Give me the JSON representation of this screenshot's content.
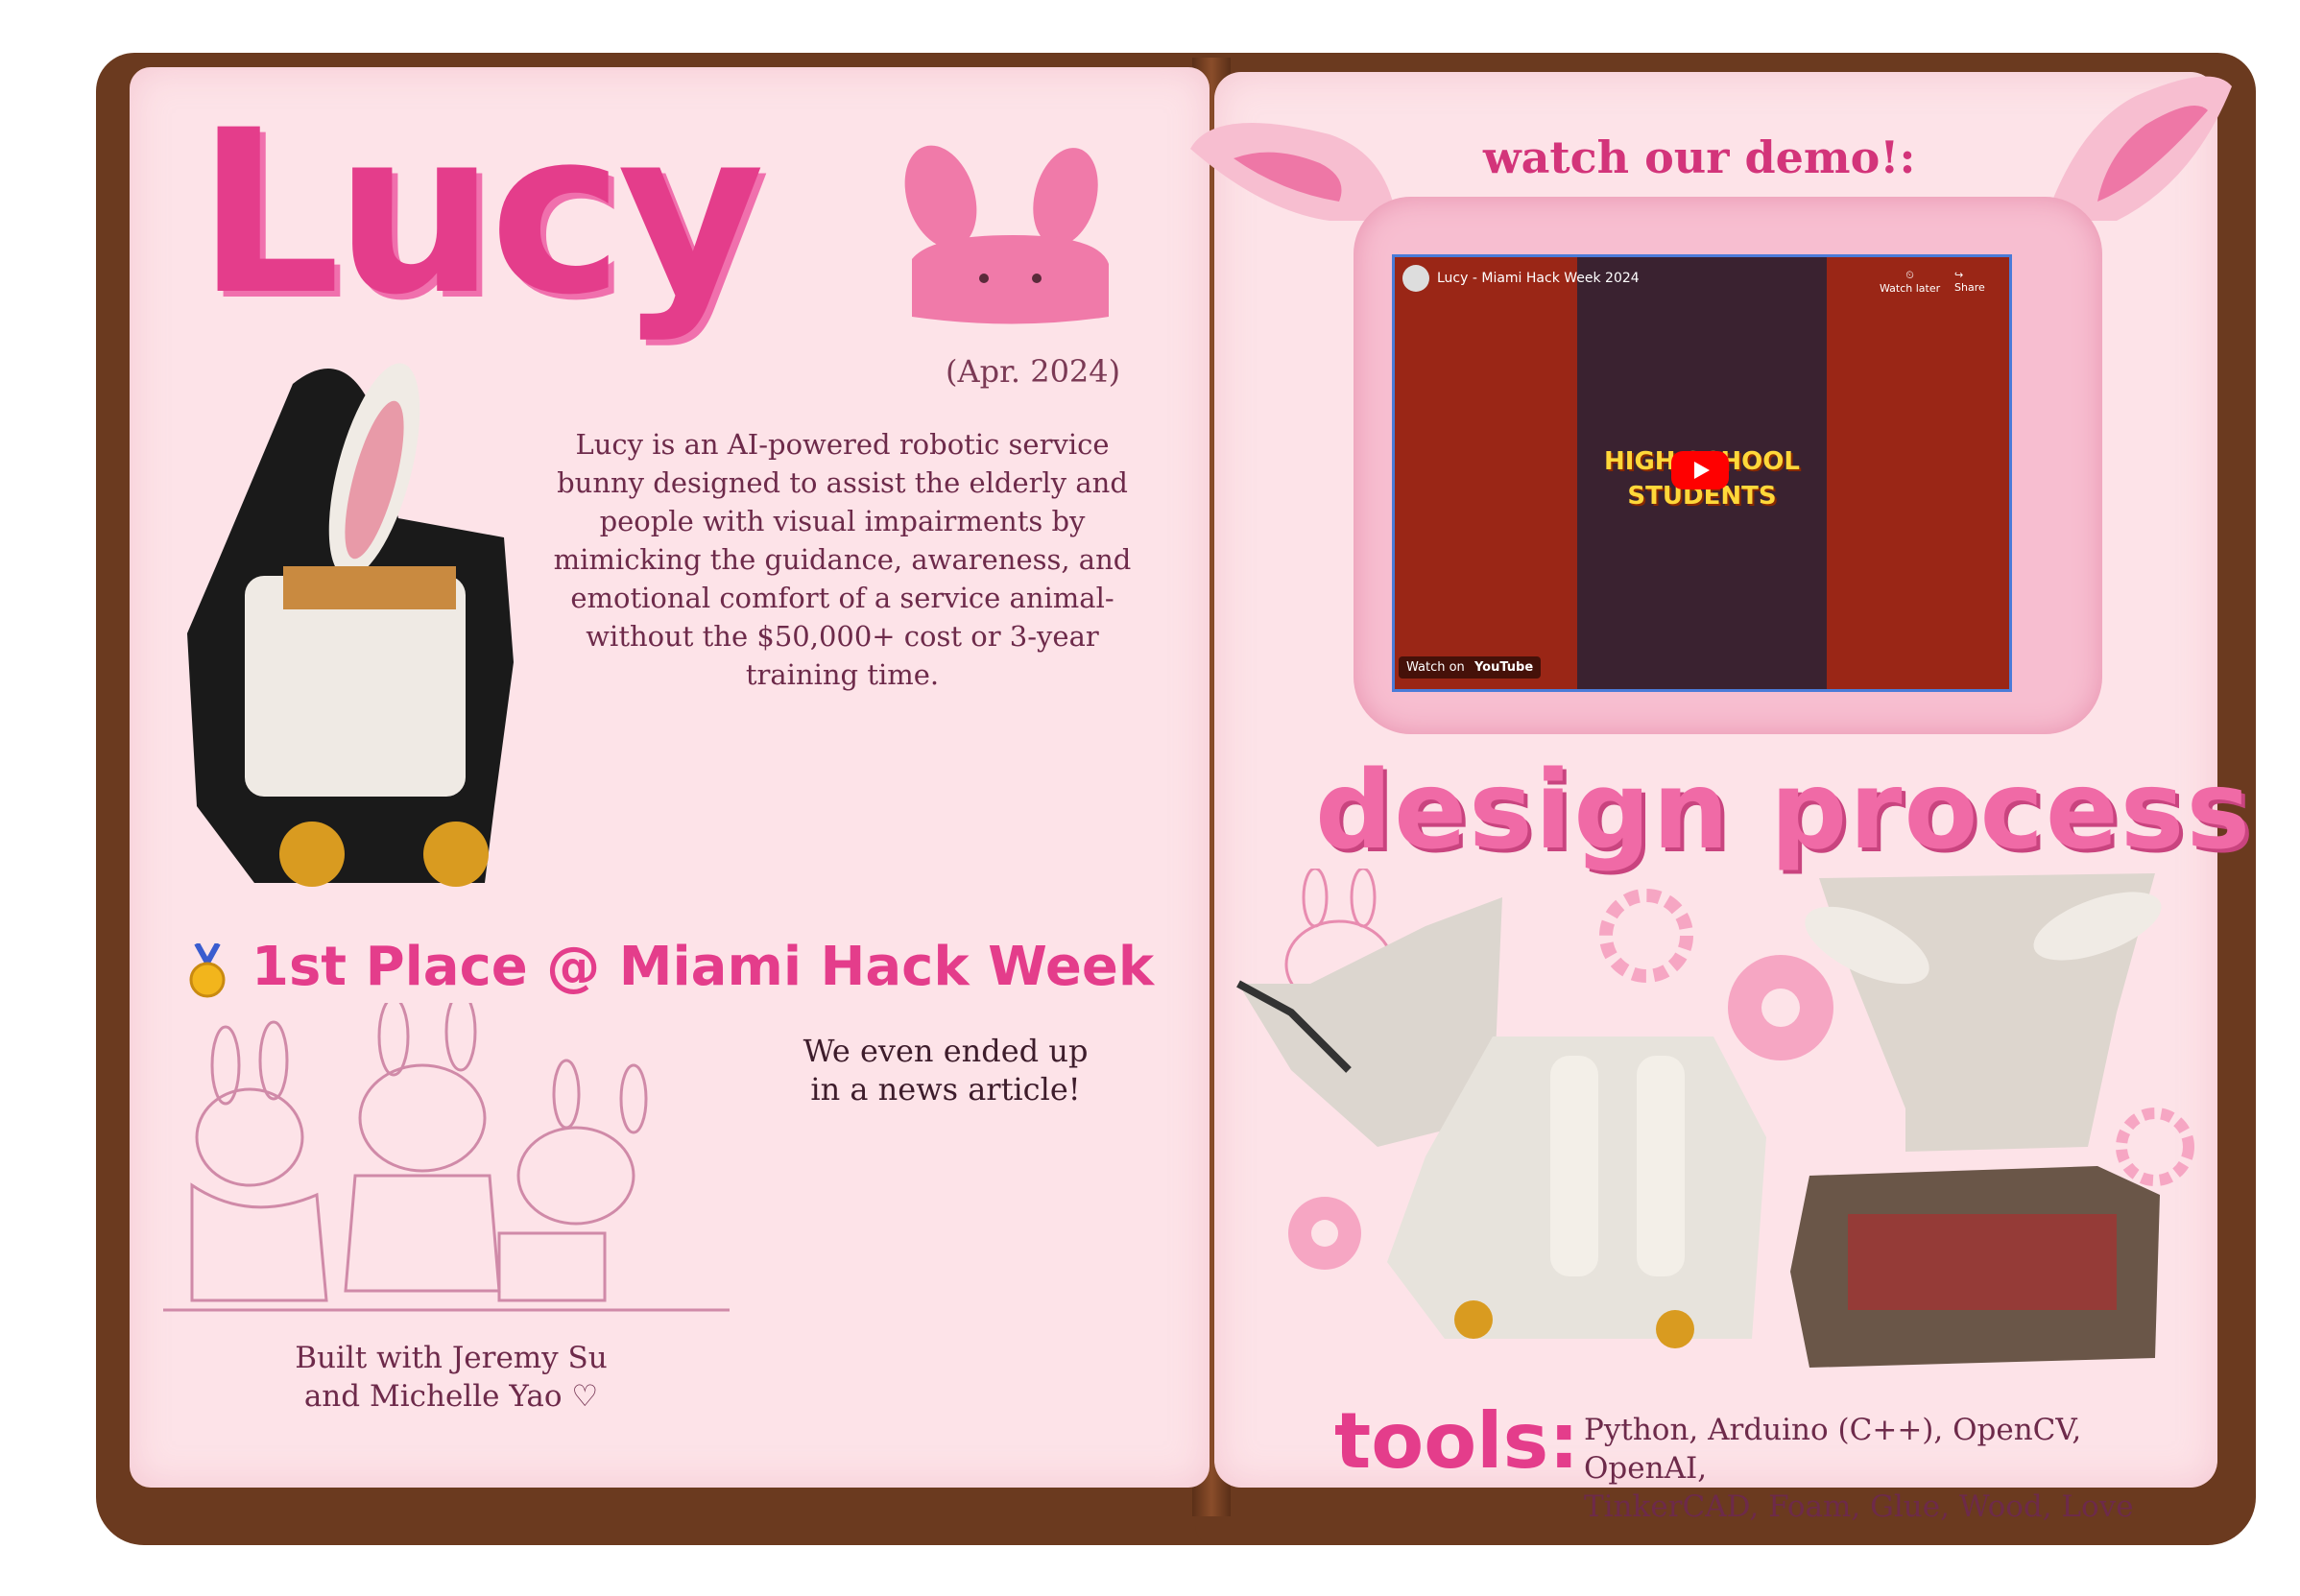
{
  "left_page": {
    "title": "Lucy",
    "date": "(Apr. 2024)",
    "description": "Lucy is an AI-powered robotic service bunny designed to assist the elderly and people with visual impairments by mimicking the guidance, awareness, and emotional comfort of a service animal-without the $50,000+ cost or 3-year training time.",
    "award": "1st Place @ Miami Hack Week",
    "news_line1": "We even ended up",
    "news_line2": "in a news article!",
    "credits_line1": "Built with Jeremy Su",
    "credits_line2": "and Michelle Yao ♡"
  },
  "right_page": {
    "demo_label": "watch our demo!:",
    "video": {
      "title": "Lucy - Miami Hack Week 2024",
      "overlay_line1": "HIGH SCHOOL",
      "overlay_line2": "STUDENTS",
      "watch_later": "Watch later",
      "share": "Share",
      "watch_on": "Watch on",
      "youtube": "YouTube"
    },
    "design_title": "design process",
    "tools_label": "tools:",
    "tools_line1": "Python, Arduino (C++), OpenCV, OpenAI,",
    "tools_line2": "TinkerCAD, Foam, Glue, Wood, Love"
  },
  "colors": {
    "page": "#fde3e8",
    "cover": "#6b3a1f",
    "accent": "#e43d8b",
    "text": "#6d2a4a"
  }
}
